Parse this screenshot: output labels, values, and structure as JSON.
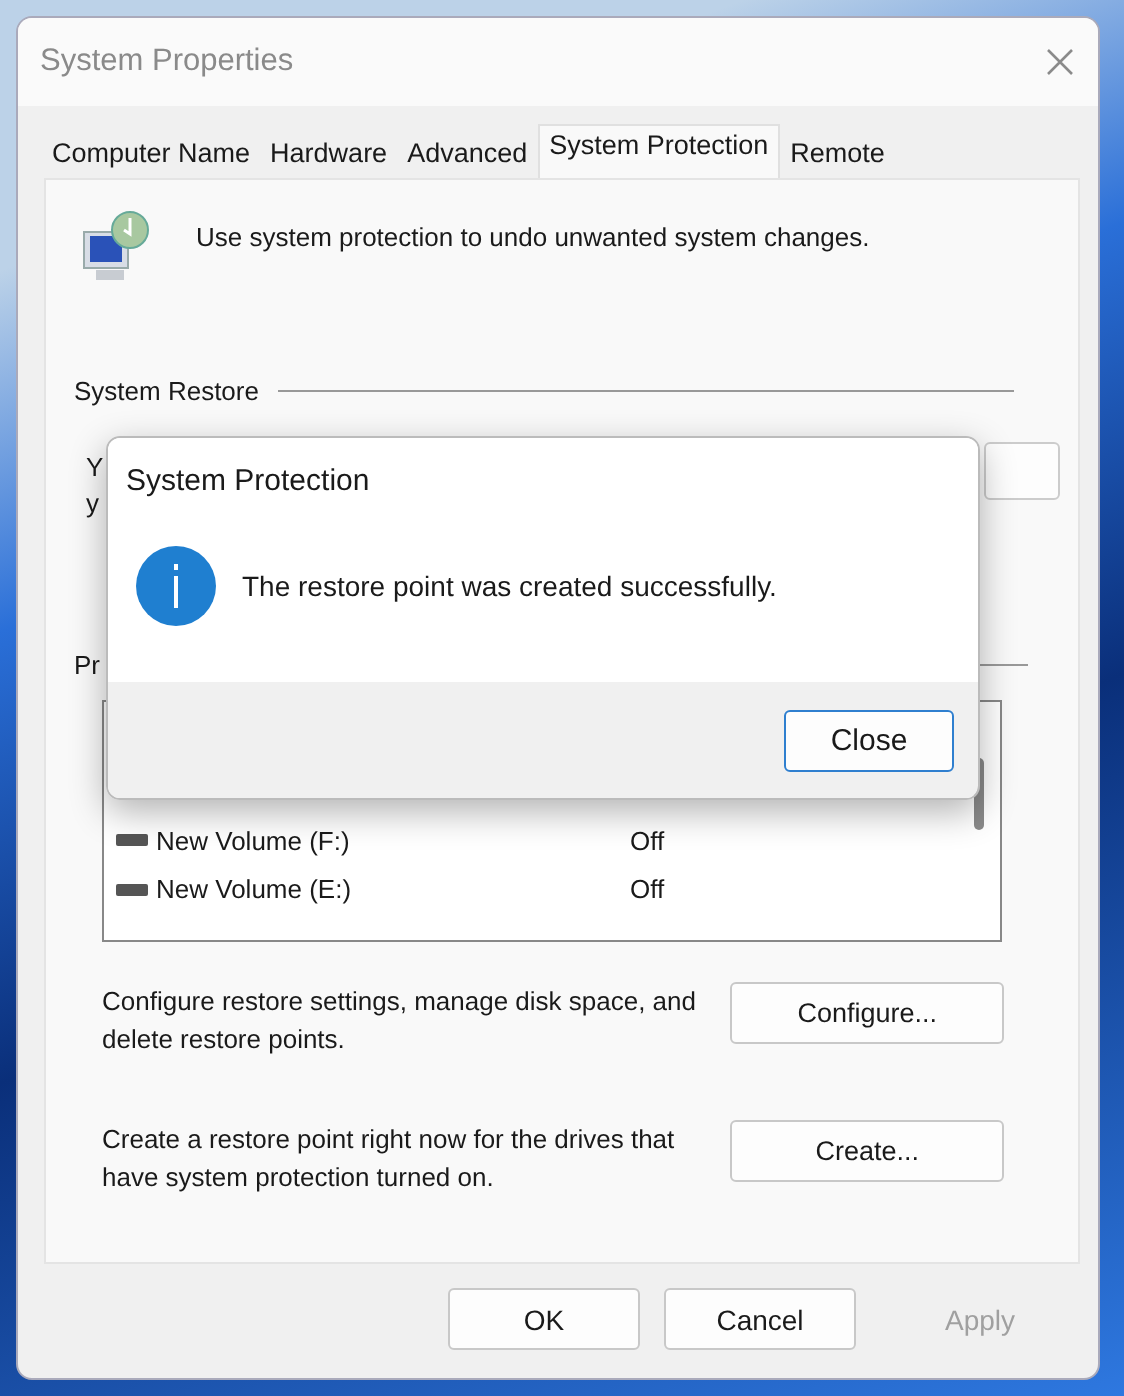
{
  "window": {
    "title": "System Properties"
  },
  "tabs": [
    {
      "label": "Computer Name",
      "selected": false
    },
    {
      "label": "Hardware",
      "selected": false
    },
    {
      "label": "Advanced",
      "selected": false
    },
    {
      "label": "System Protection",
      "selected": true
    },
    {
      "label": "Remote",
      "selected": false
    }
  ],
  "intro": "Use system protection to undo unwanted system changes.",
  "system_restore": {
    "heading": "System Restore",
    "description_lines": [
      "Y",
      "y"
    ]
  },
  "protection_settings": {
    "heading": "Pr",
    "drives": [
      {
        "name": "New Volume (F:)",
        "protection": "Off"
      },
      {
        "name": "New Volume (E:)",
        "protection": "Off"
      }
    ]
  },
  "configure": {
    "text": "Configure restore settings, manage disk space, and delete restore points.",
    "button": "Configure..."
  },
  "create": {
    "text": "Create a restore point right now for the drives that have system protection turned on.",
    "button": "Create..."
  },
  "footer_buttons": [
    {
      "label": "OK",
      "disabled": false
    },
    {
      "label": "Cancel",
      "disabled": false
    },
    {
      "label": "Apply",
      "disabled": true
    }
  ],
  "dialog": {
    "title": "System Protection",
    "message": "The restore point was created successfully.",
    "button": "Close"
  }
}
